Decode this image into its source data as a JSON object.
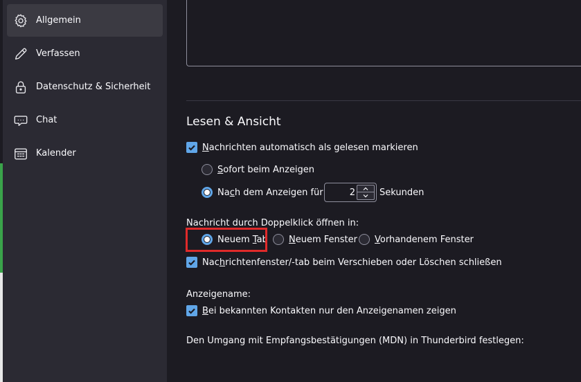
{
  "sidebar": {
    "items": [
      {
        "label": "Allgemein",
        "icon": "gear-icon",
        "active": true
      },
      {
        "label": "Verfassen",
        "icon": "pencil-icon"
      },
      {
        "label": "Datenschutz & Sicherheit",
        "icon": "lock-icon"
      },
      {
        "label": "Chat",
        "icon": "chat-icon"
      },
      {
        "label": "Kalender",
        "icon": "calendar-icon"
      }
    ]
  },
  "reading": {
    "section_title": "Lesen & Ansicht",
    "auto_mark_read": {
      "pre": "",
      "accesskey": "N",
      "post": "achrichten automatisch als gelesen markieren",
      "checked": true
    },
    "immediately": {
      "pre": "",
      "accesskey": "S",
      "post": "ofort beim Anzeigen",
      "checked": false
    },
    "after_delay": {
      "pre": "Na",
      "accesskey": "c",
      "post": "h dem Anzeigen für",
      "checked": true
    },
    "delay_value": "2",
    "delay_unit": "Sekunden",
    "open_heading": "Nachricht durch Doppelklick öffnen in:",
    "open_new_tab": {
      "pre": "Neuem ",
      "accesskey": "T",
      "post": "ab",
      "checked": true
    },
    "open_new_window": {
      "pre": "",
      "accesskey": "N",
      "post": "euem Fenster",
      "checked": false
    },
    "open_existing_window": {
      "pre": "",
      "accesskey": "V",
      "post": "orhandenem Fenster",
      "checked": false
    },
    "close_on_move": {
      "pre": "Nac",
      "accesskey": "h",
      "post": "richtenfenster/-tab beim Verschieben oder Löschen schließen",
      "checked": true
    },
    "display_name_heading": "Anzeigename:",
    "show_display_name": {
      "pre": "",
      "accesskey": "B",
      "post": "ei bekannten Kontakten nur den Anzeigenamen zeigen",
      "checked": true
    },
    "mdn_text": "Den Umgang mit Empfangsbestätigungen (MDN) in Thunderbird festlegen:"
  },
  "colors": {
    "accent": "#60a6e8",
    "highlight": "#e02a2a",
    "background": "#1c1b22",
    "sidebar": "#2b2a33"
  }
}
